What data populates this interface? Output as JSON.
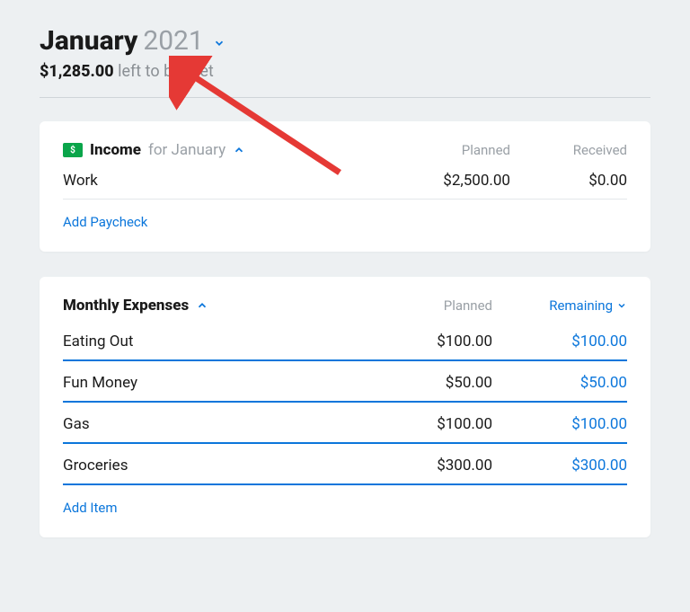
{
  "header": {
    "month": "January",
    "year": "2021",
    "left_amount": "$1,285.00",
    "left_label": "left to budget"
  },
  "income": {
    "title": "Income",
    "subtitle": "for January",
    "col_planned": "Planned",
    "col_received": "Received",
    "rows": [
      {
        "name": "Work",
        "planned": "$2,500.00",
        "received": "$0.00"
      }
    ],
    "add_label": "Add Paycheck"
  },
  "expenses": {
    "title": "Monthly Expenses",
    "col_planned": "Planned",
    "col_remaining": "Remaining",
    "rows": [
      {
        "name": "Eating Out",
        "planned": "$100.00",
        "remaining": "$100.00"
      },
      {
        "name": "Fun Money",
        "planned": "$50.00",
        "remaining": "$50.00"
      },
      {
        "name": "Gas",
        "planned": "$100.00",
        "remaining": "$100.00"
      },
      {
        "name": "Groceries",
        "planned": "$300.00",
        "remaining": "$300.00"
      }
    ],
    "add_label": "Add Item"
  }
}
